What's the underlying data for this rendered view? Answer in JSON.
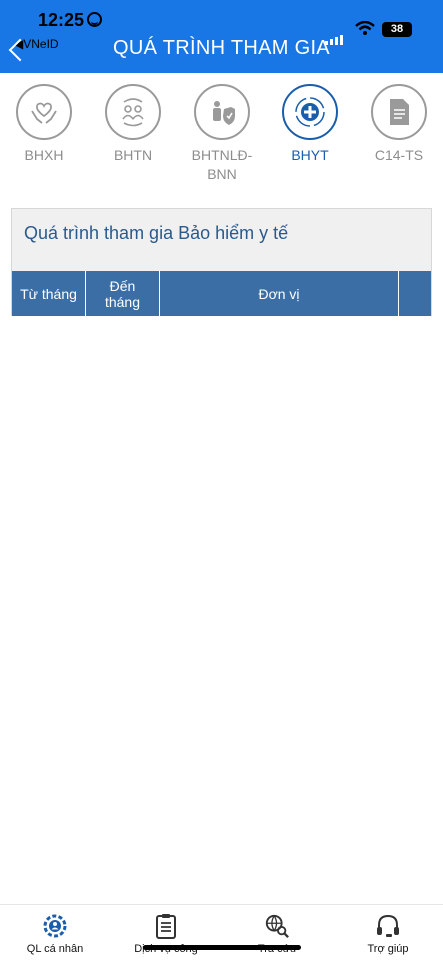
{
  "status_bar": {
    "time": "12:25",
    "battery": "38",
    "back_app": "VNeID"
  },
  "header": {
    "title": "QUÁ TRÌNH THAM GIA"
  },
  "tabs": [
    {
      "label": "BHXH",
      "icon": "hands-heart-icon",
      "active": false
    },
    {
      "label": "BHTN",
      "icon": "people-exchange-icon",
      "active": false
    },
    {
      "label": "BHTNLĐ-\nBNN",
      "icon": "worker-shield-icon",
      "active": false
    },
    {
      "label": "BHYT",
      "icon": "medical-cross-icon",
      "active": true
    },
    {
      "label": "C14-TS",
      "icon": "document-icon",
      "active": false
    }
  ],
  "panel": {
    "title": "Quá trình tham gia Bảo hiểm y tế",
    "columns": [
      "Từ tháng",
      "Đến\ntháng",
      "Đơn vị",
      ""
    ]
  },
  "bottom_nav": [
    {
      "label": "QL cá nhân",
      "icon": "gear-user-icon"
    },
    {
      "label": "Dịch vụ công",
      "icon": "clipboard-icon"
    },
    {
      "label": "Tra cứu",
      "icon": "globe-search-icon"
    },
    {
      "label": "Trợ giúp",
      "icon": "headset-icon"
    }
  ],
  "colors": {
    "header_bg": "#1877e5",
    "accent": "#1a5dab",
    "table_header_bg": "#3c6ea6",
    "inactive": "#8d8d8d"
  }
}
